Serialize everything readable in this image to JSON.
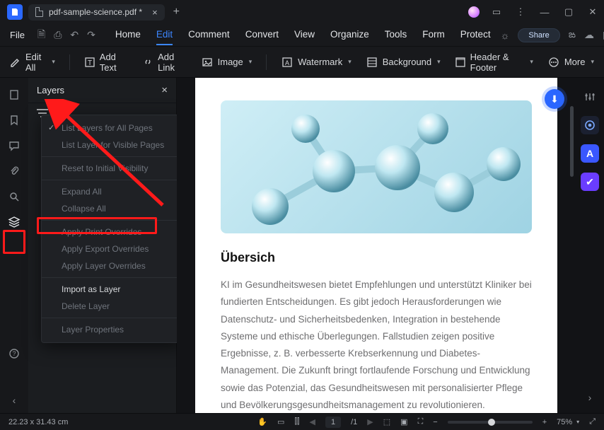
{
  "titlebar": {
    "filename": "pdf-sample-science.pdf *"
  },
  "menubar": {
    "file": "File",
    "tabs": [
      "Home",
      "Edit",
      "Comment",
      "Convert",
      "View",
      "Organize",
      "Tools",
      "Form",
      "Protect"
    ],
    "active_tab": 1,
    "share": "Share"
  },
  "toolbar": {
    "edit_all": "Edit All",
    "add_text": "Add Text",
    "add_link": "Add Link",
    "image": "Image",
    "watermark": "Watermark",
    "background": "Background",
    "header_footer": "Header & Footer",
    "more": "More"
  },
  "side_panel": {
    "title": "Layers"
  },
  "ctxmenu": {
    "list_all": "List Layers for All Pages",
    "list_visible": "List Layer for Visible Pages",
    "reset": "Reset to Initial Visibility",
    "expand": "Expand All",
    "collapse": "Collapse All",
    "apply_print": "Apply Print Overrides",
    "apply_export": "Apply Export Overrides",
    "apply_layer": "Apply Layer Overrides",
    "import": "Import as Layer",
    "delete": "Delete Layer",
    "props": "Layer Properties"
  },
  "document": {
    "heading": "Übersich",
    "body": "KI im Gesundheitswesen bietet Empfehlungen und unterstützt Kliniker bei fundierten Entscheidungen.   Es gibt jedoch Herausforderungen wie Datenschutz- und Sicherheitsbedenken, Integration in bestehende Systeme und ethische Überlegungen. Fallstudien zeigen positive Ergebnisse, z. B.   verbesserte Krebserkennung und Diabetes-Management. Die Zukunft bringt fortlaufende Forschung   und Entwicklung sowie das Potenzial, das Gesundheitswesen mit personalisierter Pflege und Bevölkerungsgesundheitsmanagement zu revolutionieren."
  },
  "status": {
    "dimensions": "22.23 x 31.43 cm",
    "page_current": "1",
    "page_total": "/1",
    "zoom": "75%"
  }
}
